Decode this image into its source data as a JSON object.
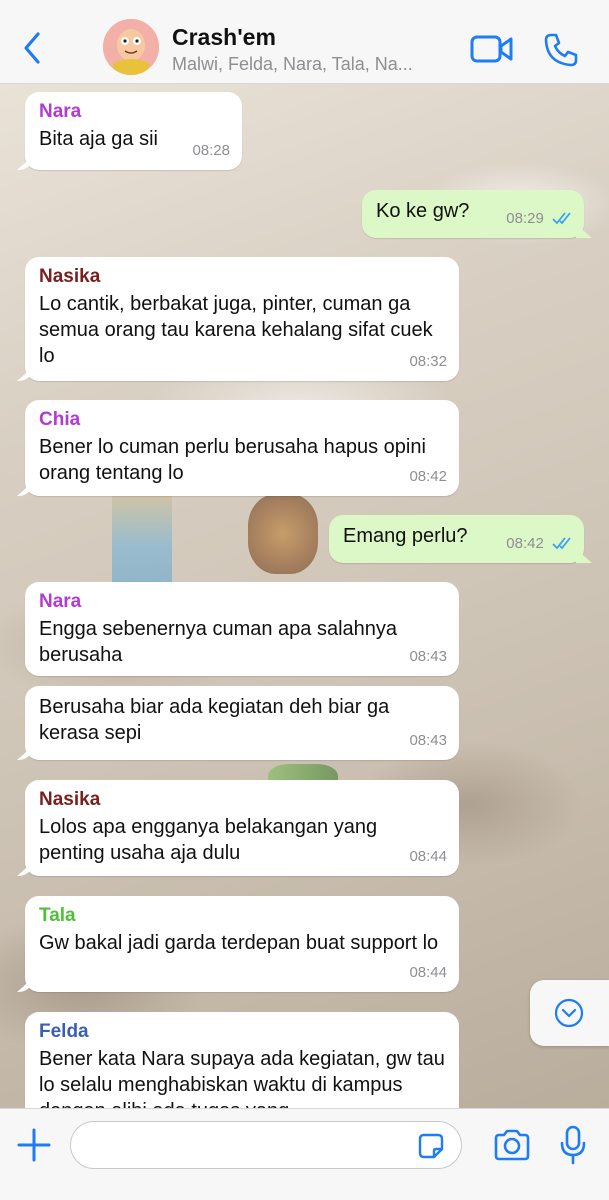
{
  "header": {
    "title": "Crash'em",
    "subtitle": "Malwi, Felda, Nara, Tala, Na..."
  },
  "messages": [
    {
      "dir": "in",
      "sender": "Nara",
      "sender_color": "#b43bd0",
      "text": "Bita aja ga sii",
      "time": "08:28"
    },
    {
      "dir": "out",
      "text": "Ko ke gw?",
      "time": "08:29"
    },
    {
      "dir": "in",
      "sender": "Nasika",
      "sender_color": "#7a1f1f",
      "text": "Lo cantik, berbakat juga, pinter, cuman ga semua orang tau karena kehalang sifat cuek lo",
      "time": "08:32"
    },
    {
      "dir": "in",
      "sender": "Chia",
      "sender_color": "#b43bd0",
      "text": "Bener lo cuman perlu berusaha hapus opini orang tentang lo",
      "time": "08:42"
    },
    {
      "dir": "out",
      "text": "Emang perlu?",
      "time": "08:42"
    },
    {
      "dir": "in",
      "sender": "Nara",
      "sender_color": "#b43bd0",
      "text": "Engga sebenernya cuman apa salahnya berusaha",
      "time": "08:43"
    },
    {
      "dir": "in",
      "text": "Berusaha biar ada kegiatan deh biar ga kerasa sepi",
      "time": "08:43"
    },
    {
      "dir": "in",
      "sender": "Nasika",
      "sender_color": "#7a1f1f",
      "text": "Lolos apa engganya belakangan yang penting usaha aja dulu",
      "time": "08:44"
    },
    {
      "dir": "in",
      "sender": "Tala",
      "sender_color": "#4fbf3a",
      "text": "Gw bakal jadi garda terdepan buat support lo",
      "time": "08:44"
    },
    {
      "dir": "in",
      "sender": "Felda",
      "sender_color": "#3b5fb0",
      "text": "Bener kata Nara supaya ada kegiatan, gw tau lo selalu menghabiskan waktu di kampus dengan alibi ada tugas yang",
      "time": ""
    }
  ],
  "input": {
    "placeholder": "",
    "value": ""
  },
  "colors": {
    "accent": "#1e7cf5",
    "outgoing_bubble": "#dcf8c6",
    "read_ticks": "#3aa3f0"
  },
  "icons": [
    "back-icon",
    "video-call-icon",
    "voice-call-icon",
    "chevron-down-icon",
    "plus-icon",
    "sticker-icon",
    "camera-icon",
    "microphone-icon"
  ]
}
